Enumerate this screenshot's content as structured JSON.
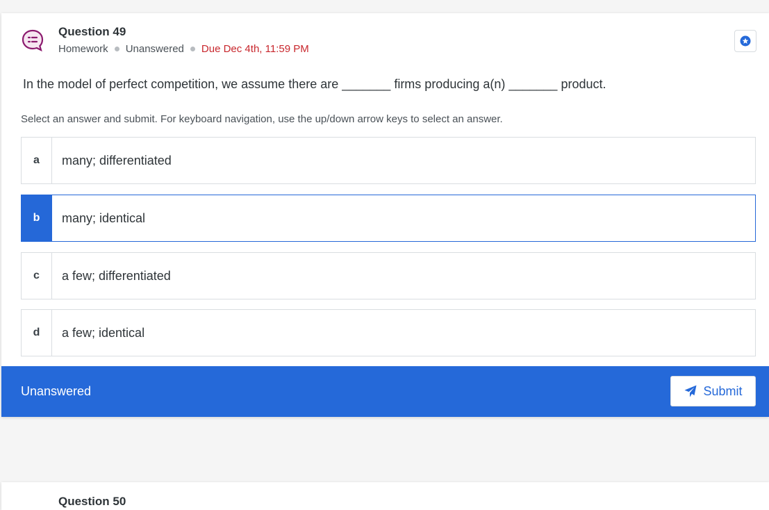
{
  "question": {
    "title": "Question 49",
    "type": "Homework",
    "status": "Unanswered",
    "due": "Due Dec 4th, 11:59 PM",
    "text": "In the model of perfect competition, we assume there are _______ firms producing a(n) _______ product.",
    "instructions": "Select an answer and submit. For keyboard navigation, use the up/down arrow keys to select an answer.",
    "options": [
      {
        "letter": "a",
        "text": "many; differentiated"
      },
      {
        "letter": "b",
        "text": "many; identical"
      },
      {
        "letter": "c",
        "text": "a few; differentiated"
      },
      {
        "letter": "d",
        "text": "a few; identical"
      }
    ],
    "selected": "b"
  },
  "footer": {
    "status": "Unanswered",
    "submit_label": "Submit"
  },
  "next_question": {
    "title": "Question 50"
  },
  "colors": {
    "accent": "#2569d9",
    "due": "#c8272d",
    "icon": "#8b1a6e"
  }
}
